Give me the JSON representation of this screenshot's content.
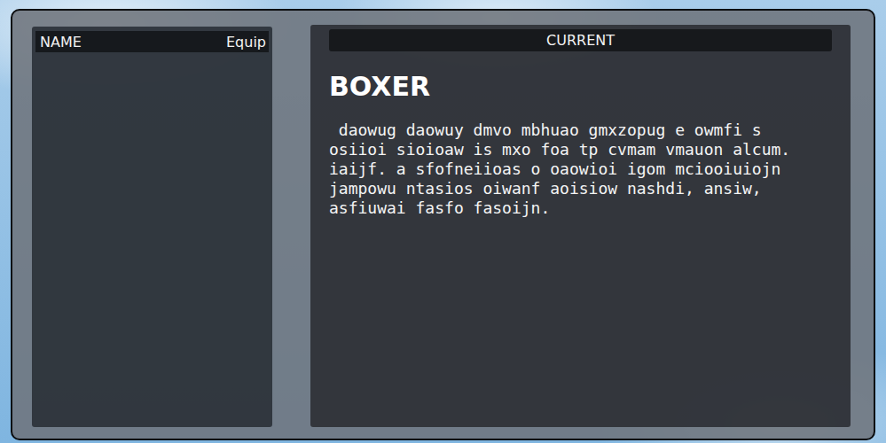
{
  "list_panel": {
    "columns": [
      "NAME",
      "Equip"
    ],
    "items": []
  },
  "detail_panel": {
    "header": "CURRENT",
    "title": "BOXER",
    "description": " daowug daowuy dmvo mbhuao gmxzopug e owmfi s osiioi sioioaw is mxo foa tp cvmam vmauon alcum. iaijf. a sfofneiioas o oaowioi igom mciooiuiojn jampowu ntasios oiwanf aoisiow nashdi, ansiw, asfiuwai fasfo fasoijn."
  }
}
